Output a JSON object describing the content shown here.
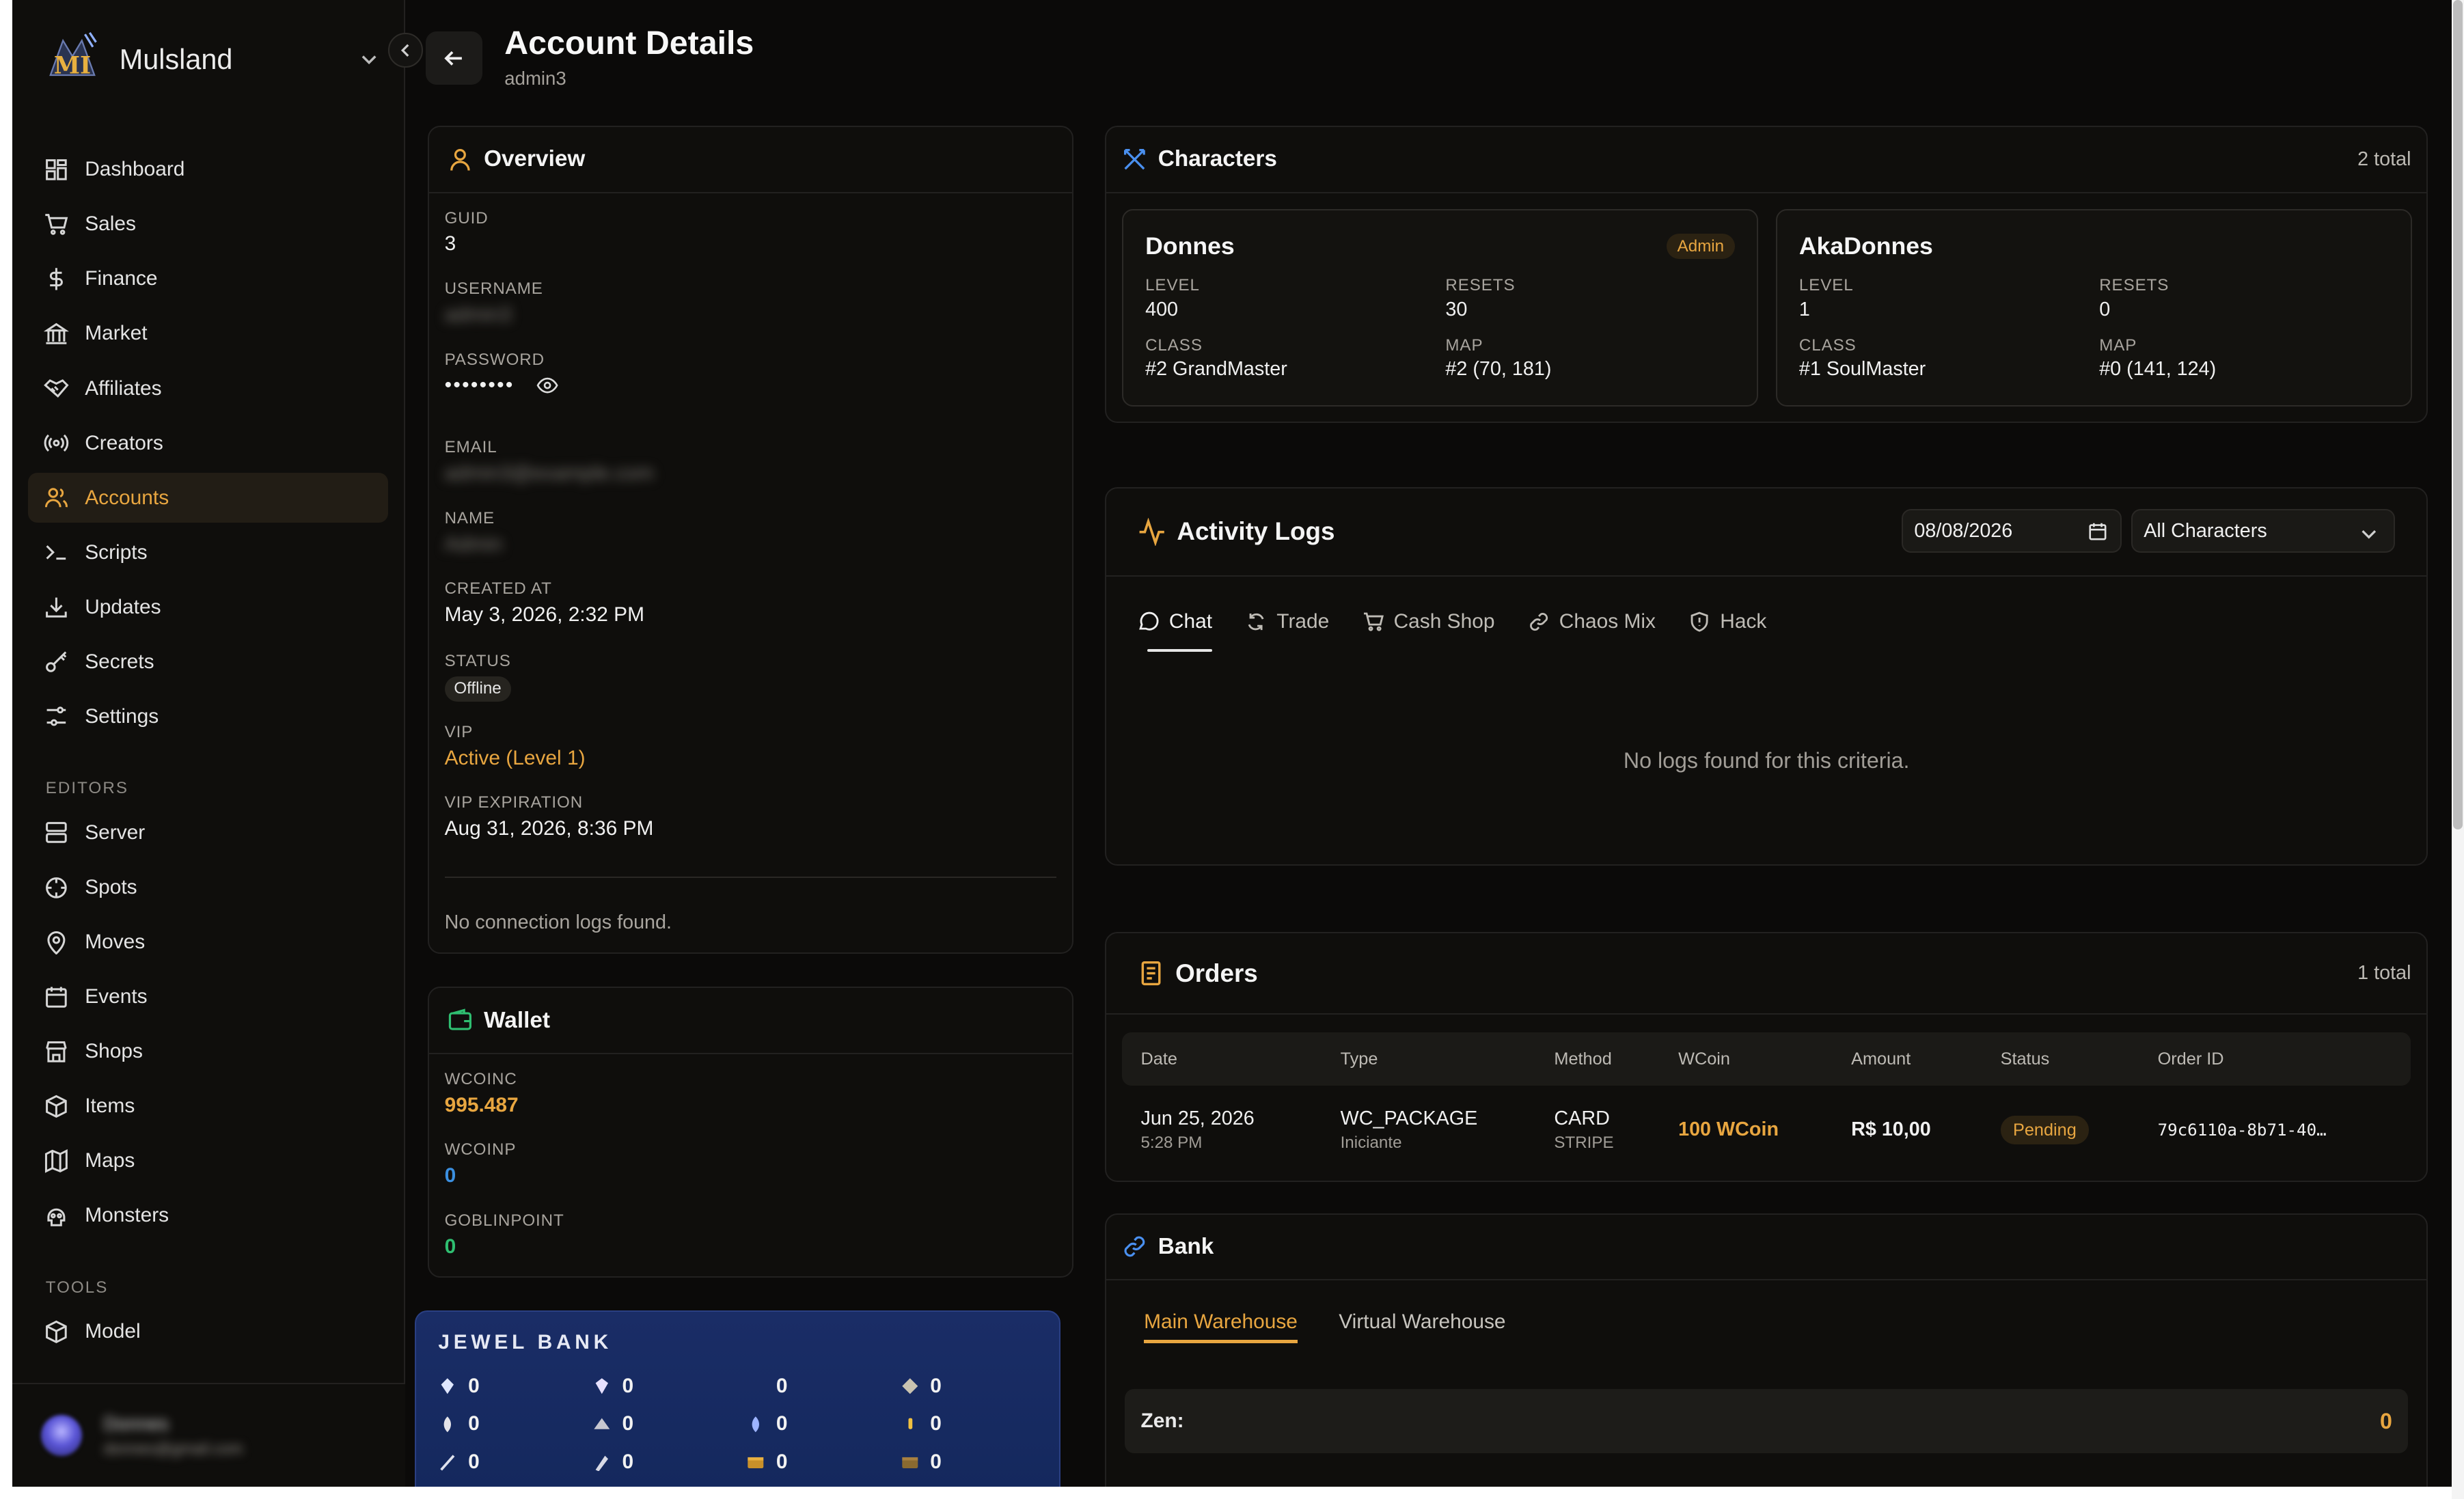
{
  "app": {
    "brand": "Mulsland",
    "collapse_icon": "chevron-left-icon"
  },
  "nav": {
    "items": [
      {
        "label": "Dashboard",
        "icon": "dashboard-icon",
        "active": false
      },
      {
        "label": "Sales",
        "icon": "cart-icon",
        "active": false
      },
      {
        "label": "Finance",
        "icon": "dollar-icon",
        "active": false
      },
      {
        "label": "Market",
        "icon": "bank-icon",
        "active": false
      },
      {
        "label": "Affiliates",
        "icon": "handshake-icon",
        "active": false
      },
      {
        "label": "Creators",
        "icon": "broadcast-icon",
        "active": false
      },
      {
        "label": "Accounts",
        "icon": "users-icon",
        "active": true
      },
      {
        "label": "Scripts",
        "icon": "terminal-icon",
        "active": false
      },
      {
        "label": "Updates",
        "icon": "download-icon",
        "active": false
      },
      {
        "label": "Secrets",
        "icon": "key-icon",
        "active": false
      },
      {
        "label": "Settings",
        "icon": "settings-icon",
        "active": false
      }
    ],
    "editors_heading": "EDITORS",
    "editors": [
      {
        "label": "Server",
        "icon": "server-icon"
      },
      {
        "label": "Spots",
        "icon": "crosshair-icon"
      },
      {
        "label": "Moves",
        "icon": "map-pin-icon"
      },
      {
        "label": "Events",
        "icon": "calendar-icon"
      },
      {
        "label": "Shops",
        "icon": "store-icon"
      },
      {
        "label": "Items",
        "icon": "package-icon"
      },
      {
        "label": "Maps",
        "icon": "map-icon"
      },
      {
        "label": "Monsters",
        "icon": "skull-icon"
      }
    ],
    "tools_heading": "TOOLS",
    "tools": [
      {
        "label": "Model",
        "icon": "box-icon"
      }
    ]
  },
  "user": {
    "name": "Donnes",
    "email": "donnes@gmail.com"
  },
  "header": {
    "title": "Account Details",
    "subtitle": "admin3"
  },
  "overview": {
    "title": "Overview",
    "guid_label": "GUID",
    "guid": "3",
    "username_label": "USERNAME",
    "username": "admin3",
    "password_label": "PASSWORD",
    "password": "••••••••",
    "email_label": "EMAIL",
    "email": "admin3@example.com",
    "name_label": "NAME",
    "name": "Admin",
    "created_label": "CREATED AT",
    "created": "May 3, 2026, 2:32 PM",
    "status_label": "STATUS",
    "status": "Offline",
    "vip_label": "VIP",
    "vip": "Active (Level 1)",
    "vip_exp_label": "VIP EXPIRATION",
    "vip_exp": "Aug 31, 2026, 8:36 PM",
    "no_conn": "No connection logs found."
  },
  "wallet": {
    "title": "Wallet",
    "wcoinc_label": "WCOINC",
    "wcoinc": "995.487",
    "wcoinp_label": "WCOINP",
    "wcoinp": "0",
    "goblin_label": "GOBLINPOINT",
    "goblin": "0"
  },
  "jewel_bank": {
    "title": "JEWEL BANK",
    "rows": [
      [
        "0",
        "0",
        "0",
        "0"
      ],
      [
        "0",
        "0",
        "0",
        "0"
      ],
      [
        "0",
        "0",
        "0",
        "0"
      ]
    ]
  },
  "characters": {
    "title": "Characters",
    "total": "2 total",
    "list": [
      {
        "name": "Donnes",
        "badge": "Admin",
        "level_label": "LEVEL",
        "level": "400",
        "resets_label": "RESETS",
        "resets": "30",
        "class_label": "CLASS",
        "class": "#2 GrandMaster",
        "map_label": "MAP",
        "map": "#2 (70, 181)"
      },
      {
        "name": "AkaDonnes",
        "badge": "",
        "level_label": "LEVEL",
        "level": "1",
        "resets_label": "RESETS",
        "resets": "0",
        "class_label": "CLASS",
        "class": "#1 SoulMaster",
        "map_label": "MAP",
        "map": "#0 (141, 124)"
      }
    ]
  },
  "activity": {
    "title": "Activity Logs",
    "date": "08/08/2026",
    "character_filter": "All Characters",
    "tabs": [
      {
        "label": "Chat",
        "icon": "message-circle-icon",
        "active": true
      },
      {
        "label": "Trade",
        "icon": "refresh-icon",
        "active": false
      },
      {
        "label": "Cash Shop",
        "icon": "cart-icon",
        "active": false
      },
      {
        "label": "Chaos Mix",
        "icon": "link-icon",
        "active": false
      },
      {
        "label": "Hack",
        "icon": "shield-alert-icon",
        "active": false
      }
    ],
    "empty": "No logs found for this criteria."
  },
  "orders": {
    "title": "Orders",
    "total": "1 total",
    "columns": [
      "Date",
      "Type",
      "Method",
      "WCoin",
      "Amount",
      "Status",
      "Order ID"
    ],
    "rows": [
      {
        "date": "Jun 25, 2026",
        "time": "5:28 PM",
        "type": "WC_PACKAGE",
        "type_sub": "Iniciante",
        "method": "CARD",
        "method_sub": "STRIPE",
        "wcoin": "100 WCoin",
        "amount": "R$ 10,00",
        "status": "Pending",
        "order_id": "79c6110a-8b71-40…"
      }
    ]
  },
  "bank": {
    "title": "Bank",
    "tabs": [
      "Main Warehouse",
      "Virtual Warehouse"
    ],
    "zen_label": "Zen:",
    "zen": "0"
  },
  "colors": {
    "accent": "#e8a640",
    "background": "#0b0a09",
    "card": "#0f0e0c",
    "wcoinp": "#3b8fe0",
    "goblin": "#2fbf71",
    "jewel_bg": "#14285d"
  }
}
